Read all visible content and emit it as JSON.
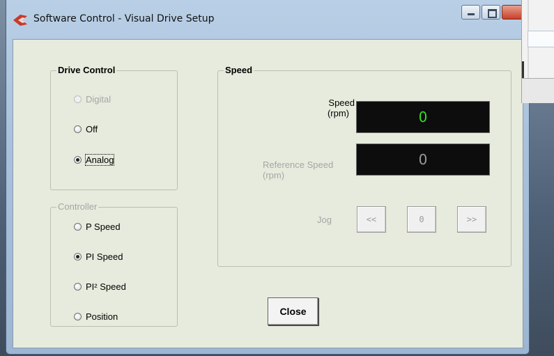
{
  "window": {
    "title": "Software Control - Visual Drive Setup",
    "accent": "#c73a2c"
  },
  "drive_control": {
    "title": "Drive Control",
    "options": [
      {
        "label": "Digital",
        "checked": false,
        "disabled": true
      },
      {
        "label": "Off",
        "checked": false,
        "disabled": false
      },
      {
        "label": "Analog",
        "checked": true,
        "disabled": false
      }
    ]
  },
  "controller": {
    "title": "Controller",
    "options": [
      {
        "label": "P Speed",
        "checked": false
      },
      {
        "label": "PI Speed",
        "checked": true
      },
      {
        "label": "PI² Speed",
        "checked": false
      },
      {
        "label": "Position",
        "checked": false
      }
    ]
  },
  "speed": {
    "title": "Speed",
    "speed_label_line1": "Speed",
    "speed_label_line2": "(rpm)",
    "speed_value": "0",
    "speed_color": "#33dd22",
    "ref_label_line1": "Reference Speed",
    "ref_label_line2": "(rpm)",
    "ref_value": "0",
    "ref_color": "#9a9a9a",
    "jog_label": "Jog",
    "jog_back": "<<",
    "jog_zero": "0",
    "jog_forward": ">>"
  },
  "close_label": "Close"
}
